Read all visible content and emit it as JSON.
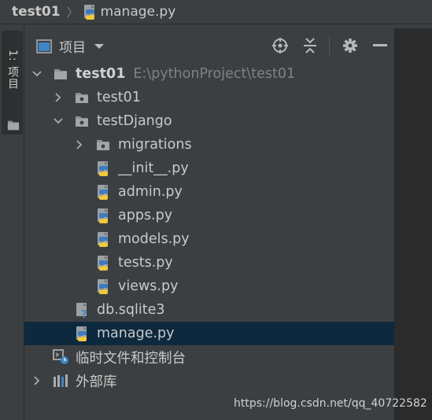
{
  "breadcrumb": {
    "root": "test01",
    "separator": "〉",
    "file": "manage.py"
  },
  "left_stripe": {
    "project_tab_label": "1: 项目"
  },
  "panel": {
    "title": "项目",
    "tools": [
      "locate-icon",
      "collapse-icon",
      "gear-icon",
      "minimize-icon"
    ]
  },
  "tree": {
    "root": {
      "name": "test01",
      "path": "E:\\pythonProject\\test01"
    },
    "test01_pkg": "test01",
    "testDjango": "testDjango",
    "migrations": "migrations",
    "init_py": "__init__.py",
    "admin_py": "admin.py",
    "apps_py": "apps.py",
    "models_py": "models.py",
    "tests_py": "tests.py",
    "views_py": "views.py",
    "db_sqlite": "db.sqlite3",
    "manage_py": "manage.py",
    "scratches": "临时文件和控制台",
    "external_libs": "外部库"
  },
  "watermark": "https://blog.csdn.net/qq_40722582",
  "colors": {
    "background": "#3c3f41",
    "selection": "#0d293e",
    "editor": "#2b2b2b",
    "text": "#bbbbbb",
    "python_blue": "#3e7bbf",
    "python_yellow": "#f0c93a"
  }
}
